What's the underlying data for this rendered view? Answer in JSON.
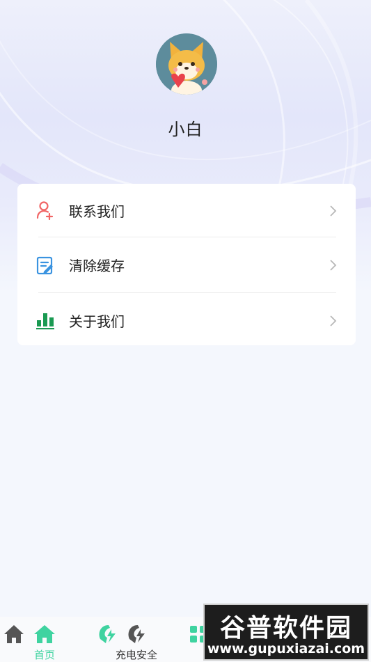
{
  "profile": {
    "username": "小白"
  },
  "menu": [
    {
      "label": "联系我们",
      "icon": "person-add-icon",
      "color": "#f16464"
    },
    {
      "label": "清除缓存",
      "icon": "document-edit-icon",
      "color": "#3a93e0"
    },
    {
      "label": "关于我们",
      "icon": "bar-chart-icon",
      "color": "#1a9a52"
    }
  ],
  "tabbar": {
    "tabs": [
      {
        "label": "首页",
        "icon": "home-icon",
        "active": true
      },
      {
        "label": "充电安全",
        "icon": "lightning-icon",
        "active": false
      },
      {
        "label": "",
        "icon": "grid-icon",
        "active": false
      },
      {
        "label": "",
        "icon": "user-icon",
        "active": false
      }
    ],
    "active_color": "#3fd3a0"
  },
  "watermark": {
    "title": "谷普软件园",
    "url": "www.gupuxiazai.com"
  }
}
